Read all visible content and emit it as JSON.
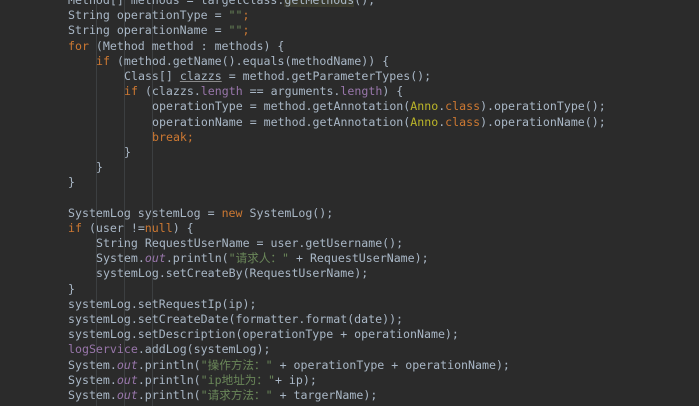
{
  "lines": [
    {
      "indent": 0,
      "tokens": [
        {
          "t": "Method",
          "k": "plain"
        },
        {
          "t": "[] methods = targetClass.",
          "k": "plain"
        },
        {
          "t": "getMethods",
          "k": "hl"
        },
        {
          "t": "();",
          "k": "plain"
        }
      ]
    },
    {
      "indent": 0,
      "tokens": [
        {
          "t": "String operationType = ",
          "k": "plain"
        },
        {
          "t": "\"\"",
          "k": "str"
        },
        {
          "t": ";",
          "k": "kw"
        }
      ]
    },
    {
      "indent": 0,
      "tokens": [
        {
          "t": "String operationName = ",
          "k": "plain"
        },
        {
          "t": "\"\"",
          "k": "str"
        },
        {
          "t": ";",
          "k": "kw"
        }
      ]
    },
    {
      "indent": 0,
      "tokens": [
        {
          "t": "for ",
          "k": "kw"
        },
        {
          "t": "(Method method : methods) {",
          "k": "plain"
        }
      ]
    },
    {
      "indent": 1,
      "tokens": [
        {
          "t": "if ",
          "k": "kw"
        },
        {
          "t": "(method.getName().equals(methodName)) {",
          "k": "plain"
        }
      ]
    },
    {
      "indent": 2,
      "tokens": [
        {
          "t": "Class[] ",
          "k": "plain"
        },
        {
          "t": "clazzs",
          "k": "uline"
        },
        {
          "t": " = method.getParameterTypes();",
          "k": "plain"
        }
      ]
    },
    {
      "indent": 2,
      "tokens": [
        {
          "t": "if ",
          "k": "kw"
        },
        {
          "t": "(clazzs.",
          "k": "plain"
        },
        {
          "t": "length",
          "k": "fld"
        },
        {
          "t": " == arguments.",
          "k": "plain"
        },
        {
          "t": "length",
          "k": "fld"
        },
        {
          "t": ") {",
          "k": "plain"
        }
      ]
    },
    {
      "indent": 3,
      "tokens": [
        {
          "t": "operationType = method.getAnnotation(",
          "k": "plain"
        },
        {
          "t": "Anno",
          "k": "ann"
        },
        {
          "t": ".",
          "k": "plain"
        },
        {
          "t": "class",
          "k": "kw"
        },
        {
          "t": ").operationType();",
          "k": "plain"
        }
      ]
    },
    {
      "indent": 3,
      "tokens": [
        {
          "t": "operationName = method.getAnnotation(",
          "k": "plain"
        },
        {
          "t": "Anno",
          "k": "ann"
        },
        {
          "t": ".",
          "k": "plain"
        },
        {
          "t": "class",
          "k": "kw"
        },
        {
          "t": ").operationName();",
          "k": "plain"
        }
      ]
    },
    {
      "indent": 3,
      "tokens": [
        {
          "t": "break",
          "k": "kw"
        },
        {
          "t": ";",
          "k": "kw"
        }
      ]
    },
    {
      "indent": 2,
      "tokens": [
        {
          "t": "}",
          "k": "plain"
        }
      ]
    },
    {
      "indent": 1,
      "tokens": [
        {
          "t": "}",
          "k": "plain"
        }
      ]
    },
    {
      "indent": 0,
      "tokens": [
        {
          "t": "}",
          "k": "plain"
        }
      ]
    },
    {
      "indent": 0,
      "tokens": []
    },
    {
      "indent": 0,
      "tokens": [
        {
          "t": "SystemLog systemLog = ",
          "k": "plain"
        },
        {
          "t": "new ",
          "k": "kw"
        },
        {
          "t": "SystemLog();",
          "k": "plain"
        }
      ]
    },
    {
      "indent": 0,
      "tokens": [
        {
          "t": "if ",
          "k": "kw"
        },
        {
          "t": "(user !=",
          "k": "plain"
        },
        {
          "t": "null",
          "k": "kw"
        },
        {
          "t": ") {",
          "k": "plain"
        }
      ]
    },
    {
      "indent": 1,
      "tokens": [
        {
          "t": "String RequestUserName = user.getUsername();",
          "k": "plain"
        }
      ]
    },
    {
      "indent": 1,
      "tokens": [
        {
          "t": "System.",
          "k": "plain"
        },
        {
          "t": "out",
          "k": "st"
        },
        {
          "t": ".println(",
          "k": "plain"
        },
        {
          "t": "\"请求人：\"",
          "k": "str"
        },
        {
          "t": " + RequestUserName);",
          "k": "plain"
        }
      ]
    },
    {
      "indent": 1,
      "tokens": [
        {
          "t": "systemLog.setCreateBy(RequestUserName);",
          "k": "plain"
        }
      ]
    },
    {
      "indent": 0,
      "tokens": [
        {
          "t": "}",
          "k": "plain"
        }
      ]
    },
    {
      "indent": 0,
      "tokens": [
        {
          "t": "systemLog.setRequestIp(ip);",
          "k": "plain"
        }
      ]
    },
    {
      "indent": 0,
      "tokens": [
        {
          "t": "systemLog.setCreateDate(formatter.format(date));",
          "k": "plain"
        }
      ]
    },
    {
      "indent": 0,
      "tokens": [
        {
          "t": "systemLog.setDescription(operationType + operationName);",
          "k": "plain"
        }
      ]
    },
    {
      "indent": 0,
      "tokens": [
        {
          "t": "logService",
          "k": "fld"
        },
        {
          "t": ".addLog(systemLog);",
          "k": "plain"
        }
      ]
    },
    {
      "indent": 0,
      "tokens": [
        {
          "t": "System.",
          "k": "plain"
        },
        {
          "t": "out",
          "k": "st"
        },
        {
          "t": ".println(",
          "k": "plain"
        },
        {
          "t": "\"操作方法：\"",
          "k": "str"
        },
        {
          "t": " + operationType + operationName);",
          "k": "plain"
        }
      ]
    },
    {
      "indent": 0,
      "tokens": [
        {
          "t": "System.",
          "k": "plain"
        },
        {
          "t": "out",
          "k": "st"
        },
        {
          "t": ".println(",
          "k": "plain"
        },
        {
          "t": "\"ip地址为：\"",
          "k": "str"
        },
        {
          "t": "+ ip);",
          "k": "plain"
        }
      ]
    },
    {
      "indent": 0,
      "tokens": [
        {
          "t": "System.",
          "k": "plain"
        },
        {
          "t": "out",
          "k": "st"
        },
        {
          "t": ".println(",
          "k": "plain"
        },
        {
          "t": "\"请求方法：\"",
          "k": "str"
        },
        {
          "t": " + targerName);",
          "k": "plain"
        }
      ]
    }
  ],
  "colors": {
    "background": "#2b2b2b",
    "plain": "#a9b7c6",
    "keyword": "#cc7832",
    "string": "#6a8759",
    "field": "#9876aa",
    "annotation": "#bbb529"
  }
}
